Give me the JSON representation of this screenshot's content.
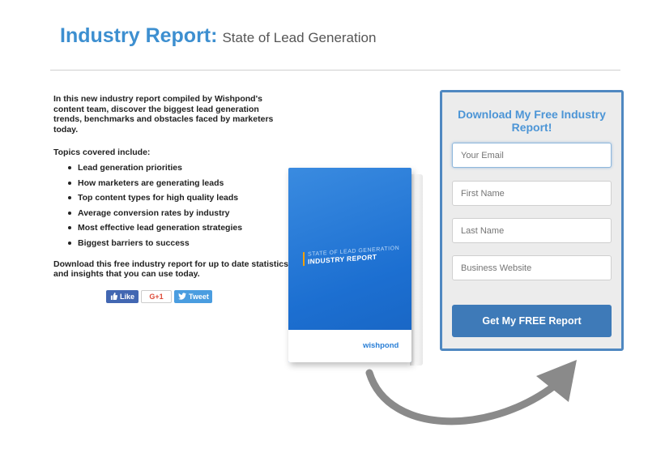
{
  "header": {
    "title_main": "Industry Report:",
    "title_sub": "State of Lead Generation"
  },
  "content": {
    "intro": "In this new industry report compiled by Wishpond's content team, discover the biggest lead generation trends, benchmarks and obstacles faced by marketers today.",
    "topics_label": "Topics covered include:",
    "topics": [
      "Lead generation priorities",
      "How marketers are generating leads",
      "Top content types for high quality leads",
      "Average conversion rates by industry",
      "Most effective lead generation strategies",
      "Biggest barriers to success"
    ],
    "outro": "Download this free industry report for up to date statistics and insights that you can use today."
  },
  "social": {
    "like": "Like",
    "gplus": "G+1",
    "tweet": "Tweet"
  },
  "book": {
    "line1": "STATE OF LEAD GENERATION",
    "line2": "INDUSTRY REPORT",
    "brand": "wishpond"
  },
  "form": {
    "title": "Download My Free Industry Report!",
    "email_placeholder": "Your Email",
    "first_name_placeholder": "First Name",
    "last_name_placeholder": "Last Name",
    "website_placeholder": "Business Website",
    "submit_label": "Get My FREE Report"
  },
  "colors": {
    "accent": "#3d8fd0",
    "form_border": "#4f88c1",
    "submit": "#3e7ab8",
    "form_bg": "#ececec"
  },
  "icons": {
    "like": "thumbs-up-icon",
    "tweet": "twitter-bird-icon",
    "arrow": "curved-arrow-icon"
  }
}
